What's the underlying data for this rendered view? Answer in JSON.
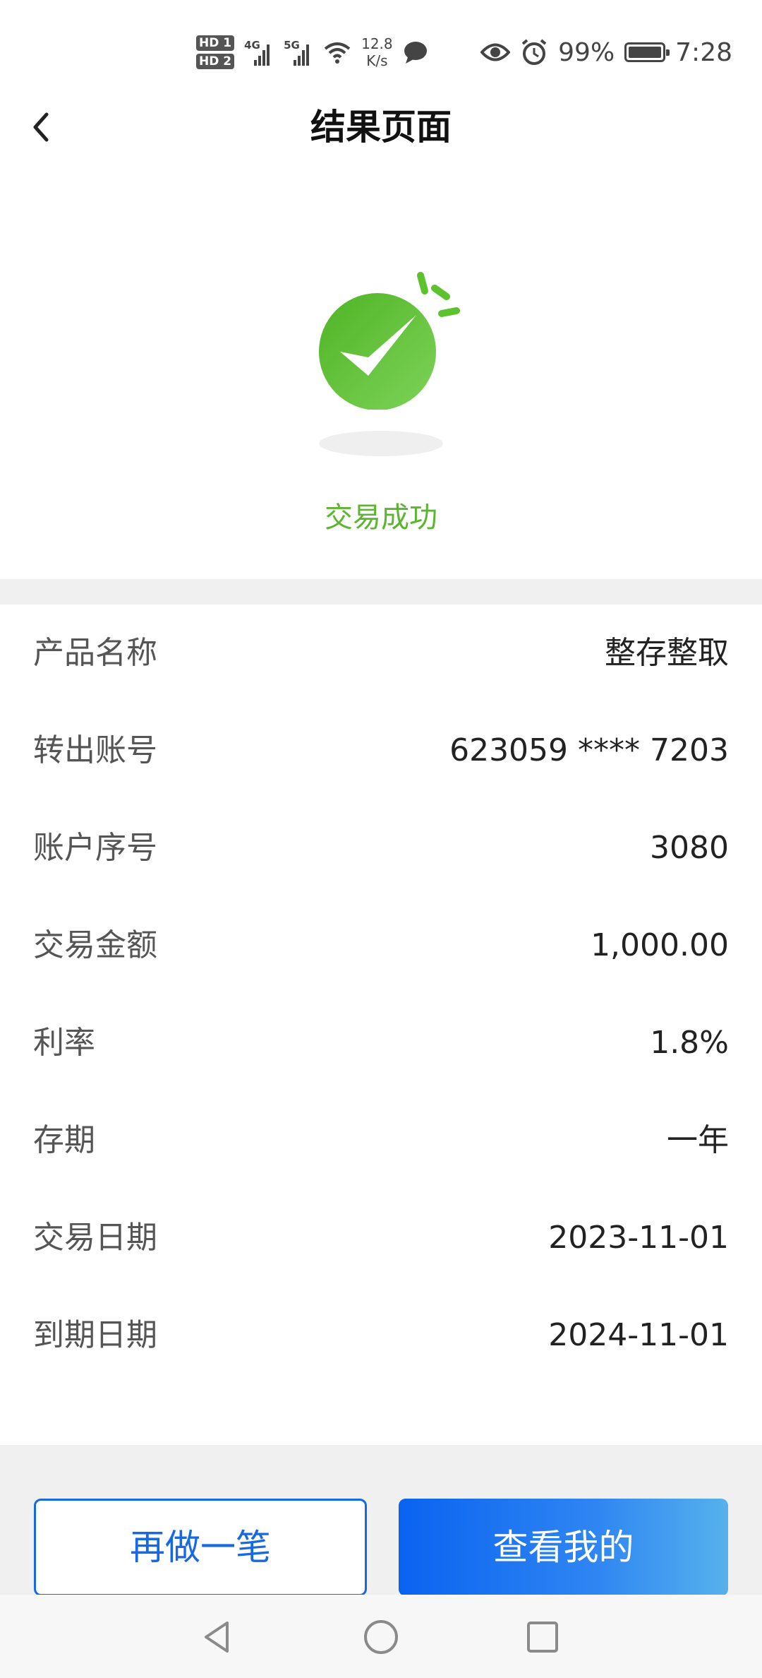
{
  "status_bar": {
    "hd1": "HD 1",
    "hd2": "HD 2",
    "sig1_label": "4G",
    "sig2_label": "5G",
    "net_speed_value": "12.8",
    "net_speed_unit": "K/s",
    "battery_percent": "99%",
    "battery_level": 0.99,
    "time": "7:28",
    "icons": [
      "hd-icon",
      "signal-4g-icon",
      "signal-5g-icon",
      "wifi-icon",
      "message-icon",
      "eye-icon",
      "alarm-icon",
      "battery-icon"
    ]
  },
  "header": {
    "title": "结果页面",
    "back_icon": "chevron-left-icon"
  },
  "result": {
    "status_text": "交易成功",
    "icon": "success-check-icon",
    "accent_color": "#5cb531"
  },
  "details": [
    {
      "label": "产品名称",
      "value": "整存整取"
    },
    {
      "label": "转出账号",
      "value": "623059 **** 7203"
    },
    {
      "label": "账户序号",
      "value": "3080"
    },
    {
      "label": "交易金额",
      "value": "1,000.00"
    },
    {
      "label": "利率",
      "value": "1.8%"
    },
    {
      "label": "存期",
      "value": "一年"
    },
    {
      "label": "交易日期",
      "value": "2023-11-01"
    },
    {
      "label": "到期日期",
      "value": "2024-11-01"
    }
  ],
  "actions": {
    "again_label": "再做一笔",
    "view_label": "查看我的",
    "primary_color": "#1668e3"
  },
  "system_nav": {
    "icons": [
      "back-triangle-icon",
      "home-circle-icon",
      "recents-square-icon"
    ]
  }
}
